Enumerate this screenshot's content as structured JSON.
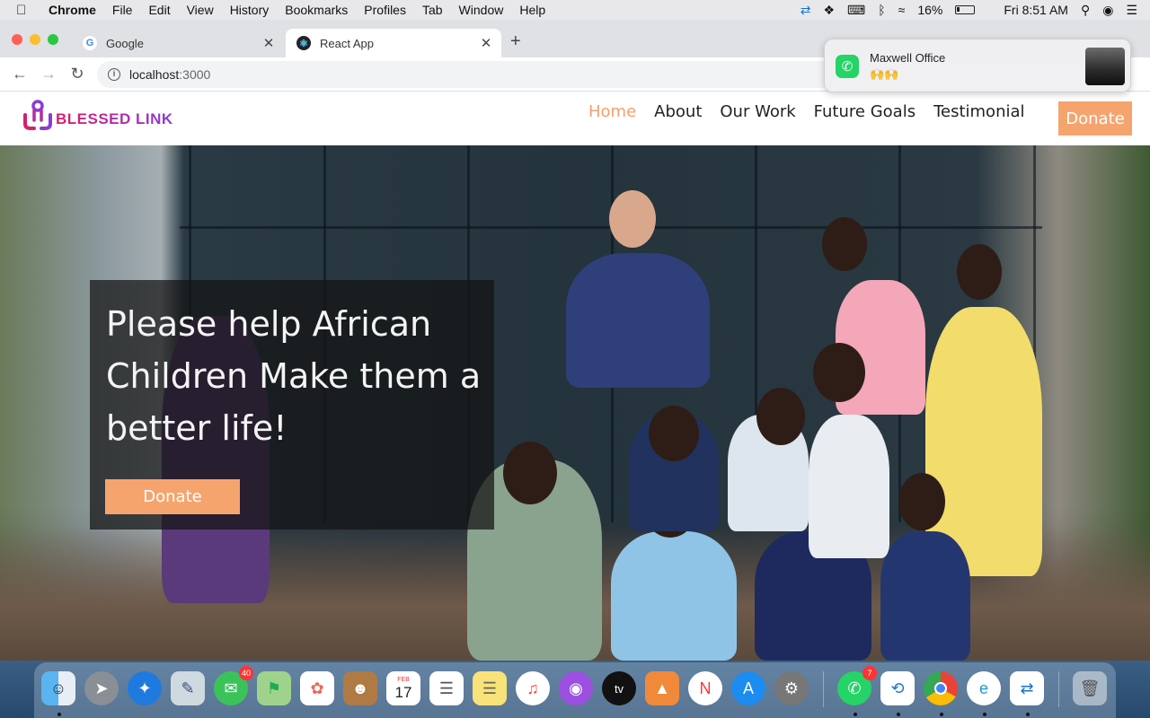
{
  "menubar": {
    "app": "Chrome",
    "items": [
      "File",
      "Edit",
      "View",
      "History",
      "Bookmarks",
      "Profiles",
      "Tab",
      "Window",
      "Help"
    ],
    "battery": "16%",
    "clock": "Fri 8:51 AM"
  },
  "browser": {
    "tabs": [
      {
        "title": "Google",
        "favicon": "google-icon"
      },
      {
        "title": "React App",
        "favicon": "react-icon"
      }
    ],
    "address": {
      "host": "localhost",
      "port": ":3000"
    }
  },
  "notification": {
    "app": "WhatsApp",
    "sender": "Maxwell Office",
    "message": "🙌🙌"
  },
  "site": {
    "brand": "BLESSED LINK",
    "nav": [
      "Home",
      "About",
      "Our Work",
      "Future Goals",
      "Testimonial"
    ],
    "nav_active": "Home",
    "nav_donate": "Donate",
    "hero": {
      "headline": "Please help African Children Make them a better life!",
      "cta": "Donate"
    },
    "colors": {
      "accent": "#f6a46e",
      "logo_start": "#d8206a",
      "logo_end": "#8a3cd6"
    }
  },
  "dock": {
    "apps": [
      {
        "name": "Finder",
        "icon": "finder-icon"
      },
      {
        "name": "Launchpad",
        "icon": "launchpad-icon"
      },
      {
        "name": "Safari",
        "icon": "safari-icon"
      },
      {
        "name": "Preview",
        "icon": "preview-icon"
      },
      {
        "name": "Messages",
        "icon": "messages-icon",
        "badge": "40"
      },
      {
        "name": "Maps",
        "icon": "maps-icon"
      },
      {
        "name": "Photos",
        "icon": "photos-icon"
      },
      {
        "name": "Contacts",
        "icon": "contacts-icon"
      },
      {
        "name": "Calendar",
        "icon": "calendar-icon",
        "month": "FEB",
        "day": "17"
      },
      {
        "name": "Reminders",
        "icon": "reminders-icon"
      },
      {
        "name": "Notes",
        "icon": "notes-icon"
      },
      {
        "name": "Music",
        "icon": "music-icon"
      },
      {
        "name": "Podcasts",
        "icon": "podcasts-icon"
      },
      {
        "name": "TV",
        "icon": "tv-icon",
        "label": "tv"
      },
      {
        "name": "Keynote",
        "icon": "keynote-icon"
      },
      {
        "name": "News",
        "icon": "news-icon"
      },
      {
        "name": "App Store",
        "icon": "app-store-icon"
      },
      {
        "name": "System Preferences",
        "icon": "settings-icon"
      },
      {
        "name": "WhatsApp",
        "icon": "whatsapp-icon",
        "badge": "7"
      },
      {
        "name": "VS Code",
        "icon": "vscode-icon"
      },
      {
        "name": "Chrome",
        "icon": "chrome-icon"
      },
      {
        "name": "Edge",
        "icon": "edge-icon"
      },
      {
        "name": "TeamViewer",
        "icon": "teamviewer-icon"
      },
      {
        "name": "Trash",
        "icon": "trash-icon"
      }
    ]
  }
}
